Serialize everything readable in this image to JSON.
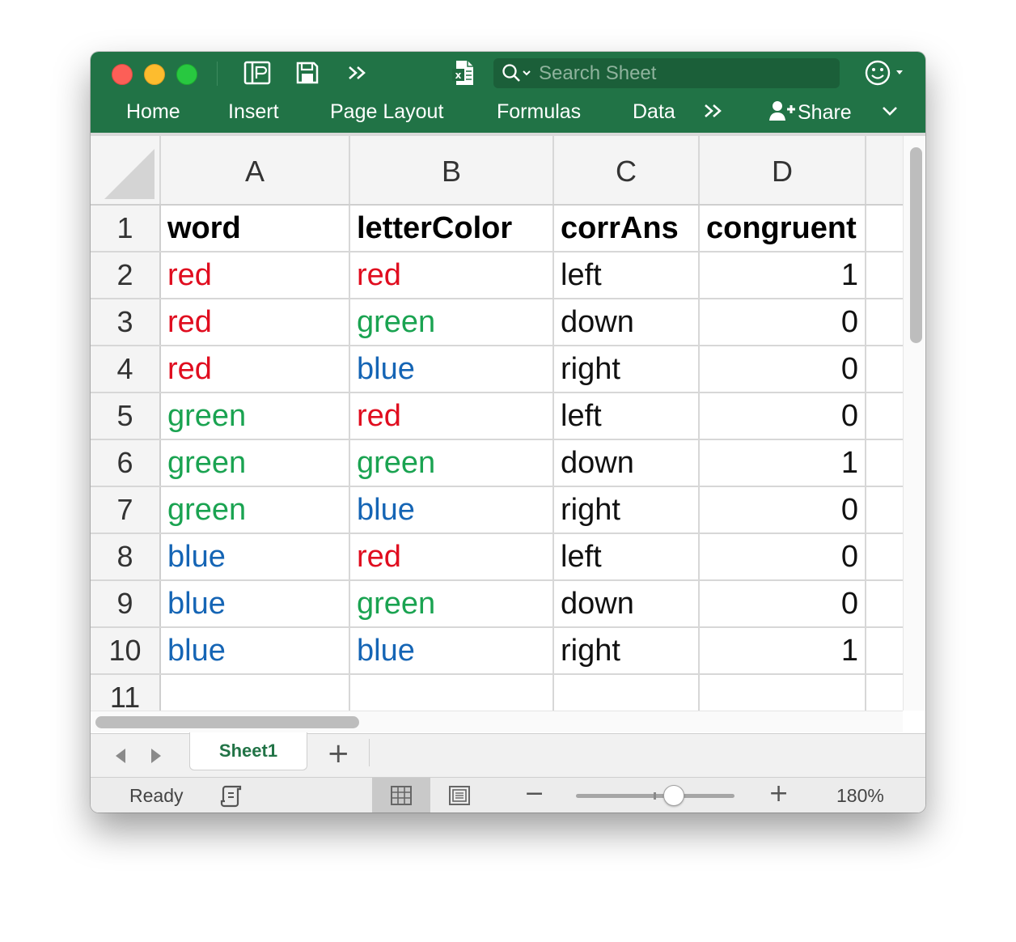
{
  "toolbar": {
    "search_placeholder": "Search Sheet",
    "icons": [
      "sidebar-toggle-icon",
      "save-icon",
      "more-chevrons-icon",
      "excel-file-icon",
      "search-icon",
      "smiley-feedback-icon"
    ]
  },
  "ribbon": {
    "tabs": [
      "Home",
      "Insert",
      "Page Layout",
      "Formulas",
      "Data"
    ],
    "share_label": "Share"
  },
  "colors": {
    "brand_green": "#217346",
    "red": "#e00d1f",
    "green": "#1aa351",
    "blue": "#1565b5"
  },
  "sheet": {
    "columns": [
      "A",
      "B",
      "C",
      "D"
    ],
    "row_numbers": [
      "1",
      "2",
      "3",
      "4",
      "5",
      "6",
      "7",
      "8",
      "9",
      "10",
      "11"
    ],
    "headers": [
      "word",
      "letterColor",
      "corrAns",
      "congruent"
    ],
    "rows": [
      {
        "word": "red",
        "word_color": "red",
        "letterColor": "red",
        "letterColor_color": "red",
        "corrAns": "left",
        "congruent": "1"
      },
      {
        "word": "red",
        "word_color": "red",
        "letterColor": "green",
        "letterColor_color": "green",
        "corrAns": "down",
        "congruent": "0"
      },
      {
        "word": "red",
        "word_color": "red",
        "letterColor": "blue",
        "letterColor_color": "blue",
        "corrAns": "right",
        "congruent": "0"
      },
      {
        "word": "green",
        "word_color": "green",
        "letterColor": "red",
        "letterColor_color": "red",
        "corrAns": "left",
        "congruent": "0"
      },
      {
        "word": "green",
        "word_color": "green",
        "letterColor": "green",
        "letterColor_color": "green",
        "corrAns": "down",
        "congruent": "1"
      },
      {
        "word": "green",
        "word_color": "green",
        "letterColor": "blue",
        "letterColor_color": "blue",
        "corrAns": "right",
        "congruent": "0"
      },
      {
        "word": "blue",
        "word_color": "blue",
        "letterColor": "red",
        "letterColor_color": "red",
        "corrAns": "left",
        "congruent": "0"
      },
      {
        "word": "blue",
        "word_color": "blue",
        "letterColor": "green",
        "letterColor_color": "green",
        "corrAns": "down",
        "congruent": "0"
      },
      {
        "word": "blue",
        "word_color": "blue",
        "letterColor": "blue",
        "letterColor_color": "blue",
        "corrAns": "right",
        "congruent": "1"
      }
    ]
  },
  "sheet_tabs": {
    "active": "Sheet1",
    "add_label": "+"
  },
  "status": {
    "ready": "Ready",
    "zoom_minus": "−",
    "zoom_plus": "+",
    "zoom_level": "180%",
    "zoom_percent": 180
  }
}
